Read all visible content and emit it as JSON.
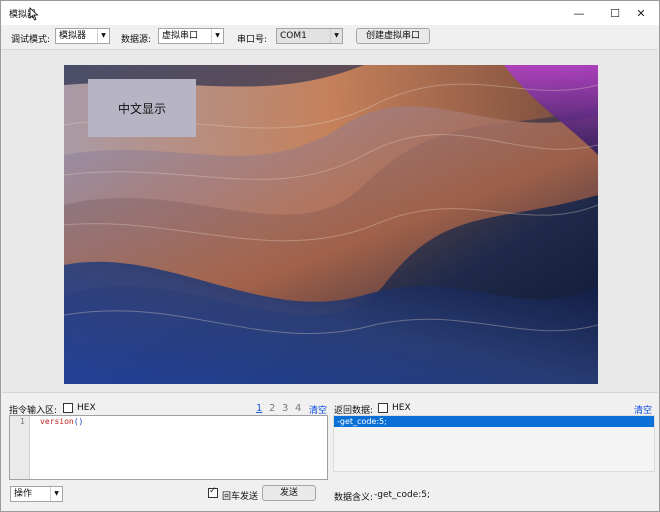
{
  "window": {
    "title": "模拟器",
    "minimize": "—",
    "maximize": "☐",
    "close": "✕"
  },
  "toolbar": {
    "debug_mode_label": "调试模式:",
    "debug_mode_value": "模拟器",
    "data_source_label": "数据源:",
    "data_source_value": "虚拟串口",
    "port_label": "串口号:",
    "port_value": "COM1",
    "create_port_button": "创建虚拟串口",
    "dropdown_arrow": "▼"
  },
  "display": {
    "chinese_display": "中文显示"
  },
  "command_panel": {
    "label": "指令输入区:",
    "hex_label": "HEX",
    "hex_checked": false,
    "pages": [
      "1",
      "2",
      "3",
      "4"
    ],
    "active_page": "1",
    "clear_label": "清空",
    "line_number": "1",
    "code_func": "version",
    "code_parens": "()",
    "operation_value": "操作",
    "cr_send_label": "回车发送",
    "cr_send_checked": true,
    "send_button": "发送"
  },
  "return_panel": {
    "label": "返回数据:",
    "hex_label": "HEX",
    "hex_checked": false,
    "clear_label": "清空",
    "selected_row": "-get_code:5;",
    "meaning_label": "数据含义:",
    "meaning_value": "-get_code:5;"
  }
}
